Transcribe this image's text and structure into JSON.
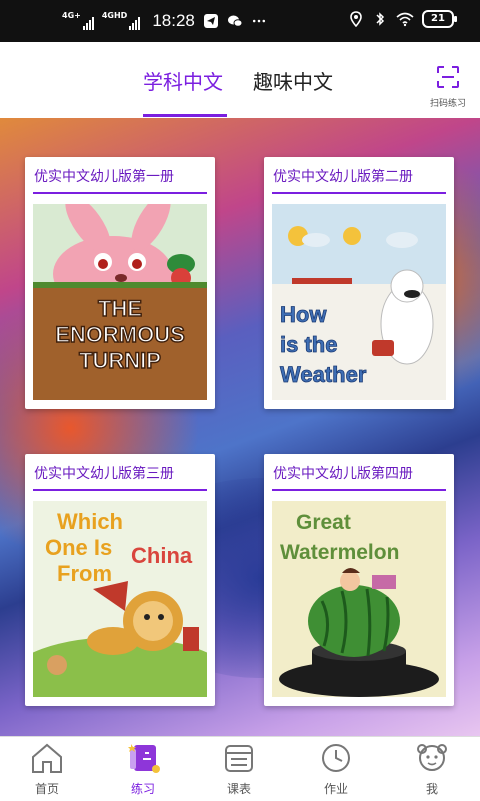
{
  "status_bar": {
    "net1_tag": "4G+",
    "net2_tag": "4GHD",
    "time": "18:28",
    "battery": "21"
  },
  "header": {
    "tabs": [
      {
        "label": "学科中文",
        "active": true
      },
      {
        "label": "趣味中文",
        "active": false
      }
    ],
    "scan_label": "扫码练习",
    "accent_color": "#7b1fe0"
  },
  "books": [
    {
      "title": "优实中文幼儿版第一册",
      "cover_text": [
        "THE",
        "ENORMOUS",
        "TURNIP"
      ]
    },
    {
      "title": "优实中文幼儿版第二册",
      "cover_text": [
        "How",
        "is the",
        "Weather"
      ]
    },
    {
      "title": "优实中文幼儿版第三册",
      "cover_text": [
        "Which",
        "One Is",
        "From",
        "China"
      ]
    },
    {
      "title": "优实中文幼儿版第四册",
      "cover_text": [
        "Great",
        "Watermelon"
      ]
    }
  ],
  "bottom_nav": [
    {
      "label": "首页",
      "icon": "home-icon",
      "active": false
    },
    {
      "label": "练习",
      "icon": "practice-icon",
      "active": true
    },
    {
      "label": "课表",
      "icon": "schedule-icon",
      "active": false
    },
    {
      "label": "作业",
      "icon": "clock-icon",
      "active": false
    },
    {
      "label": "我",
      "icon": "profile-icon",
      "active": false
    }
  ]
}
